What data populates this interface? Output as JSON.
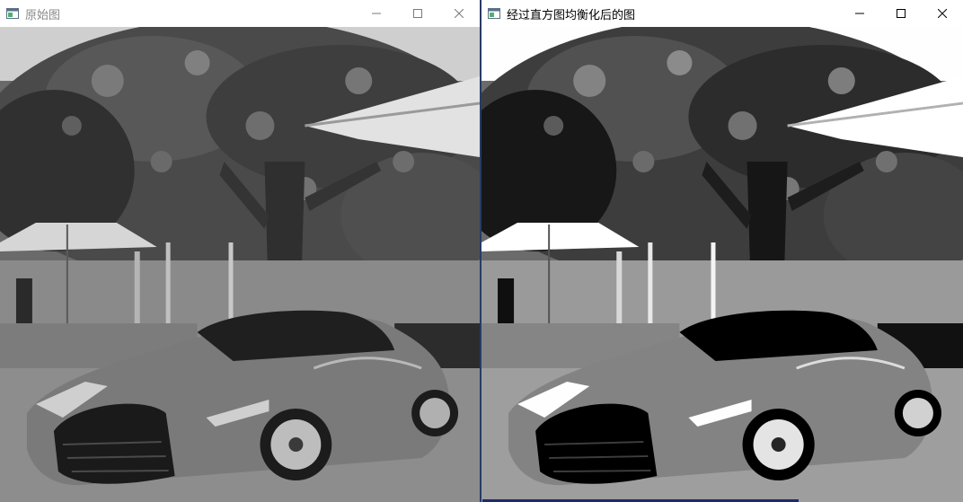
{
  "windows": [
    {
      "id": "original",
      "title": "原始图",
      "active": false,
      "image_semantic": "grayscale-photo-car-under-tree",
      "controls": [
        "minimize-icon",
        "maximize-icon",
        "close-icon"
      ]
    },
    {
      "id": "equalized",
      "title": "经过直方图均衡化后的图",
      "active": true,
      "image_semantic": "grayscale-photo-car-under-tree-histogram-equalized",
      "controls": [
        "minimize-icon",
        "maximize-icon",
        "close-icon"
      ]
    }
  ],
  "colors": {
    "title_inactive": "#8a8a8a",
    "title_active": "#000000",
    "window_border": "#283a66",
    "desktop": "#3b3f44"
  }
}
